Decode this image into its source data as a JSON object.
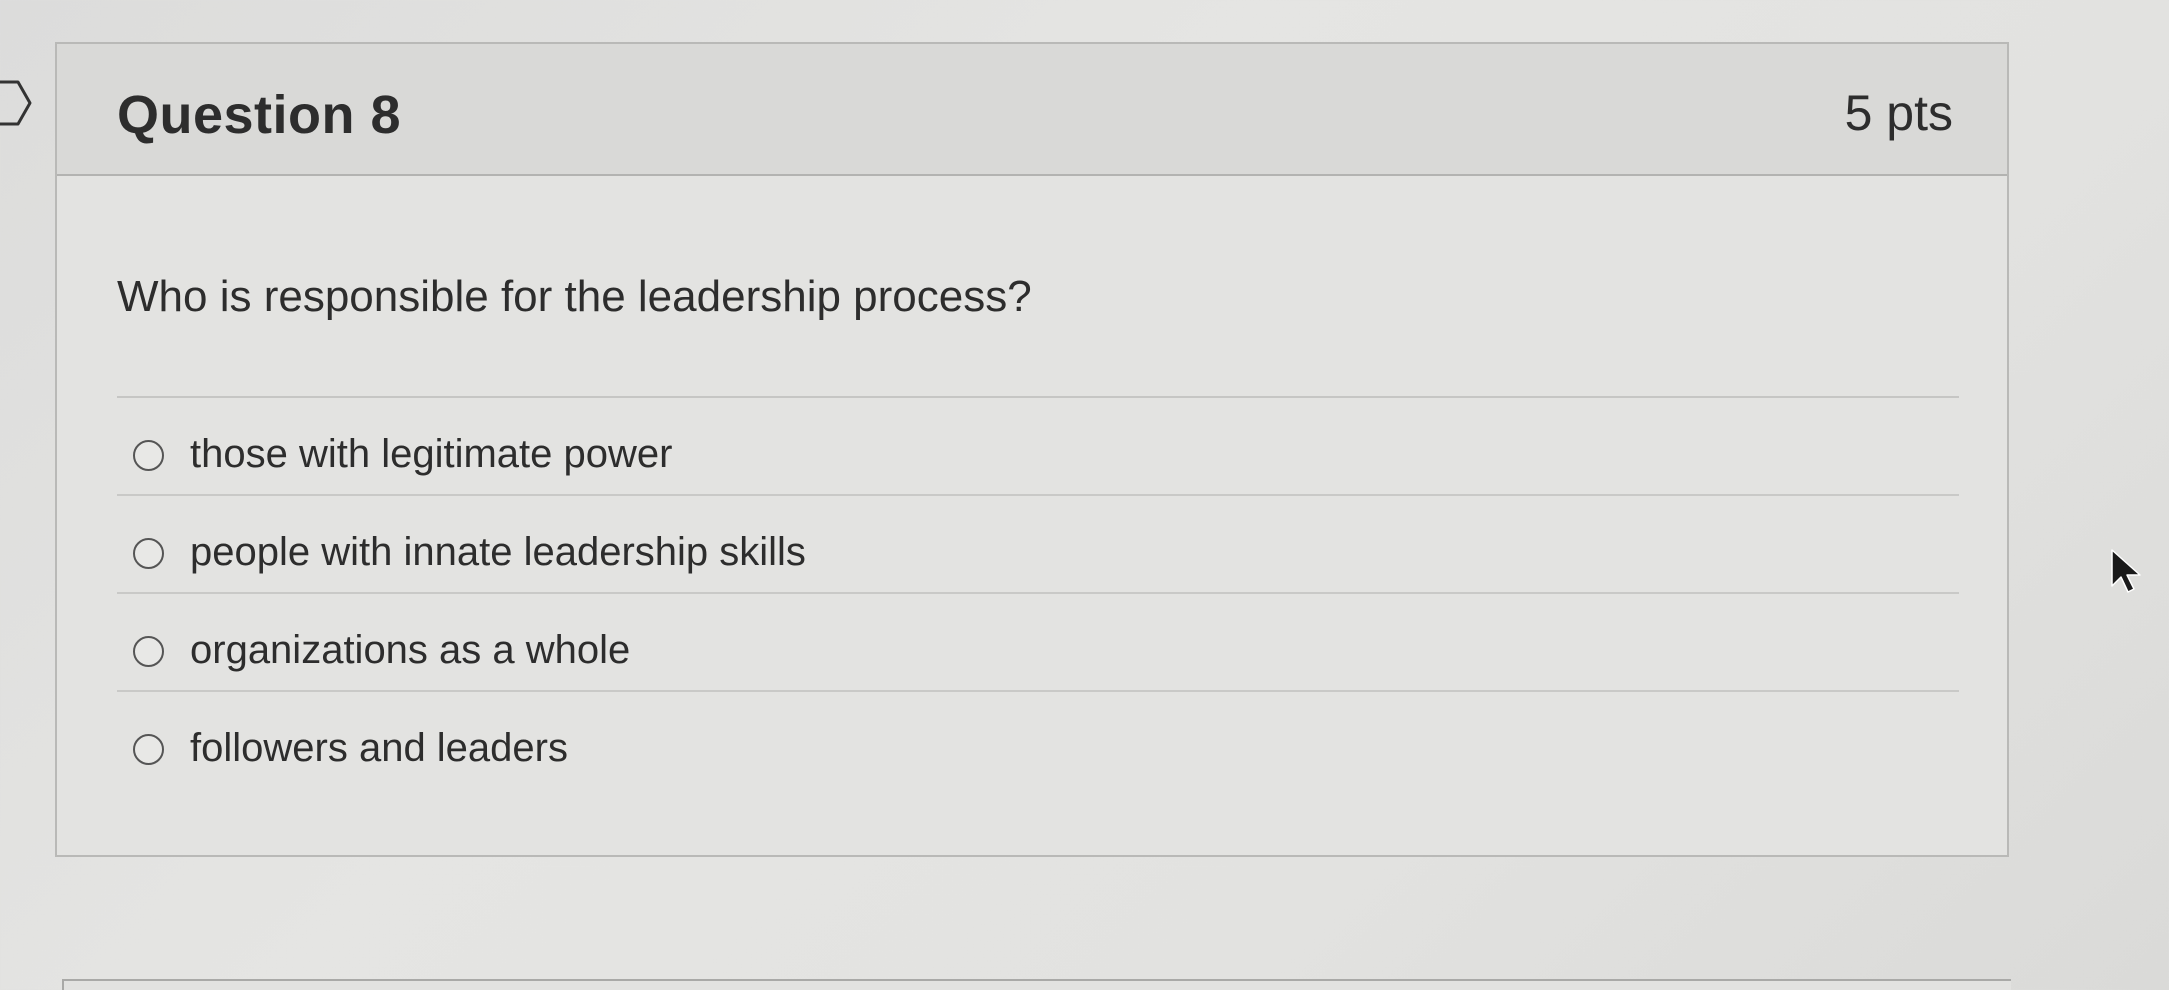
{
  "question": {
    "title": "Question 8",
    "points": "5 pts",
    "text": "Who is responsible for the leadership process?",
    "answers": [
      {
        "label": "those with legitimate power",
        "selected": false
      },
      {
        "label": "people with innate leadership skills",
        "selected": false
      },
      {
        "label": "organizations as a whole",
        "selected": false
      },
      {
        "label": "followers and leaders",
        "selected": false
      }
    ]
  },
  "icons": {
    "flag": "flag-marker-icon",
    "radio": "radio-unselected-icon",
    "cursor": "mouse-pointer-icon"
  },
  "colors": {
    "header_bg": "#d9d9d7",
    "card_bg": "#e3e3e1",
    "text": "#2d2d2d",
    "border": "#b9b9b7"
  }
}
